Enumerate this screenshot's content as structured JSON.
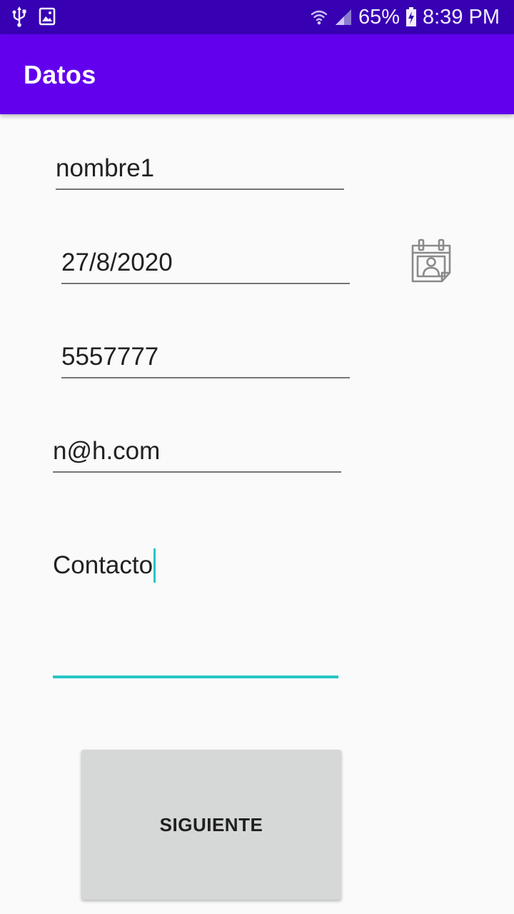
{
  "status_bar": {
    "battery": "65%",
    "time": "8:39 PM",
    "icons": [
      "usb-icon",
      "image-icon",
      "wifi-icon",
      "signal-icon",
      "battery-charging-icon"
    ]
  },
  "app_bar": {
    "title": "Datos"
  },
  "form": {
    "name": "nombre1",
    "date": "27/8/2020",
    "phone": "5557777",
    "email": "n@h.com",
    "contact": "Contacto",
    "calendar_icon": "calendar-contact-icon",
    "next_label": "SIGUIENTE"
  },
  "colors": {
    "status_bar": "#3700b3",
    "app_bar": "#6200ee",
    "accent": "#26c6c4",
    "background": "#fafafa",
    "button": "#d6d7d7"
  }
}
